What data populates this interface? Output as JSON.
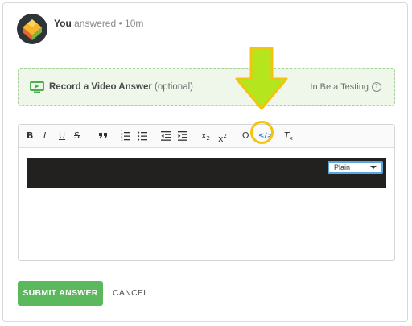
{
  "header": {
    "name": "You",
    "status_text": "answered",
    "separator": "•",
    "time": "10m"
  },
  "video_answer": {
    "label": "Record a Video Answer",
    "optional": "(optional)",
    "beta": "In Beta Testing",
    "help_symbol": "?"
  },
  "toolbar": {
    "bold": "B",
    "italic": "I",
    "underline": "U",
    "strike": "S",
    "subscript": "x",
    "subscript_sub": "2",
    "superscript": "x",
    "superscript_sup": "2",
    "omega": "Ω",
    "code": "</>",
    "clear_format": "T",
    "clear_format_sub": "x",
    "icons": [
      "bold-icon",
      "italic-icon",
      "underline-icon",
      "strikethrough-icon",
      "quote-icon",
      "ordered-list-icon",
      "bullet-list-icon",
      "outdent-icon",
      "indent-icon",
      "subscript-icon",
      "superscript-icon",
      "special-character-icon",
      "code-block-icon",
      "clear-format-icon"
    ]
  },
  "code_block": {
    "language": "Plain"
  },
  "actions": {
    "submit": "SUBMIT ANSWER",
    "cancel": "CANCEL"
  },
  "colors": {
    "submit": "#5cb85c",
    "video_bg": "#eef7ea",
    "video_border": "#a6d39a",
    "code_bg": "#22211f",
    "arrow": "#b5e61d",
    "arrow_outline": "#f1c40f",
    "highlight": "#f1c40f"
  }
}
